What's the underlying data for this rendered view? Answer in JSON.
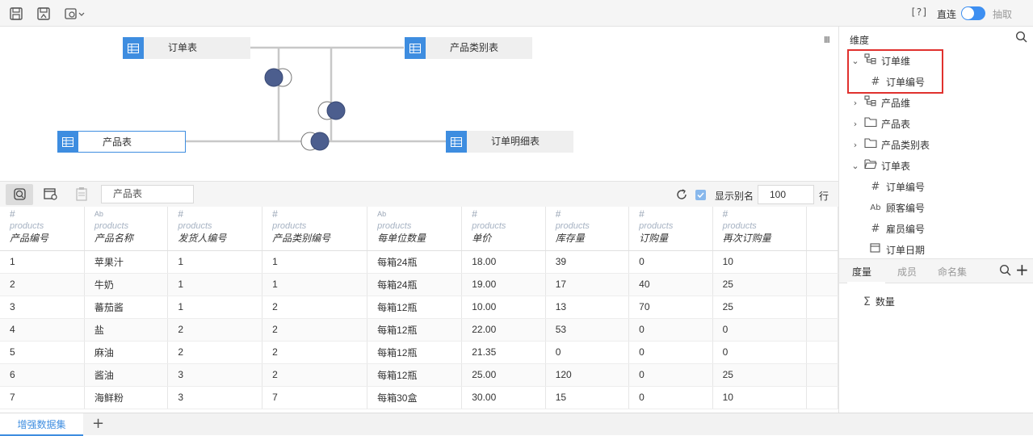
{
  "toolbar": {
    "help_label": "[?]",
    "direct_label": "直连",
    "extract_label": "抽取",
    "icons": [
      "save-icon",
      "save-as-icon",
      "settings-dropdown-icon"
    ]
  },
  "diagram": {
    "menu_glyph": "III",
    "tables": [
      {
        "label": "订单表"
      },
      {
        "label": "产品类别表"
      },
      {
        "label": "产品表"
      },
      {
        "label": "订单明细表"
      }
    ]
  },
  "preview": {
    "table_select_value": "产品表",
    "show_alias_label": "显示别名",
    "rows_value": "100",
    "rows_unit": "行"
  },
  "grid": {
    "columns": [
      {
        "type_glyph": "#",
        "type": "number",
        "source": "products",
        "name": "产品编号"
      },
      {
        "type_glyph": "Ab",
        "type": "text",
        "source": "products",
        "name": "产品名称"
      },
      {
        "type_glyph": "#",
        "type": "number",
        "source": "products",
        "name": "发货人编号"
      },
      {
        "type_glyph": "#",
        "type": "number",
        "source": "products",
        "name": "产品类别编号"
      },
      {
        "type_glyph": "Ab",
        "type": "text",
        "source": "products",
        "name": "每单位数量"
      },
      {
        "type_glyph": "#",
        "type": "number",
        "source": "products",
        "name": "单价"
      },
      {
        "type_glyph": "#",
        "type": "number",
        "source": "products",
        "name": "库存量"
      },
      {
        "type_glyph": "#",
        "type": "number",
        "source": "products",
        "name": "订购量"
      },
      {
        "type_glyph": "#",
        "type": "number",
        "source": "products",
        "name": "再次订购量"
      },
      {
        "type_glyph": "",
        "type": "number",
        "source": "",
        "name": ""
      }
    ],
    "rows": [
      [
        "1",
        "苹果汁",
        "1",
        "1",
        "每箱24瓶",
        "18.00",
        "39",
        "0",
        "10",
        ""
      ],
      [
        "2",
        "牛奶",
        "1",
        "1",
        "每箱24瓶",
        "19.00",
        "17",
        "40",
        "25",
        ""
      ],
      [
        "3",
        "蕃茄酱",
        "1",
        "2",
        "每箱12瓶",
        "10.00",
        "13",
        "70",
        "25",
        ""
      ],
      [
        "4",
        "盐",
        "2",
        "2",
        "每箱12瓶",
        "22.00",
        "53",
        "0",
        "0",
        ""
      ],
      [
        "5",
        "麻油",
        "2",
        "2",
        "每箱12瓶",
        "21.35",
        "0",
        "0",
        "0",
        ""
      ],
      [
        "6",
        "酱油",
        "3",
        "2",
        "每箱12瓶",
        "25.00",
        "120",
        "0",
        "25",
        ""
      ],
      [
        "7",
        "海鲜粉",
        "3",
        "7",
        "每箱30盒",
        "30.00",
        "15",
        "0",
        "10",
        ""
      ]
    ]
  },
  "right_panel": {
    "dimension_title": "维度",
    "tree": [
      {
        "label": "订单维",
        "chevron": "⌄",
        "icon": "hierarchy-icon",
        "glyph": "",
        "level": 0
      },
      {
        "label": "订单编号",
        "chevron": "",
        "icon": "number-icon",
        "glyph": "#",
        "level": 1
      },
      {
        "label": "产品维",
        "chevron": "›",
        "icon": "hierarchy-icon",
        "glyph": "",
        "level": 0
      },
      {
        "label": "产品表",
        "chevron": "›",
        "icon": "folder-icon",
        "glyph": "",
        "level": 0
      },
      {
        "label": "产品类别表",
        "chevron": "›",
        "icon": "folder-icon",
        "glyph": "",
        "level": 0
      },
      {
        "label": "订单表",
        "chevron": "⌄",
        "icon": "folder-open-icon",
        "glyph": "",
        "level": 0
      },
      {
        "label": "订单编号",
        "chevron": "",
        "icon": "number-icon",
        "glyph": "#",
        "level": 1
      },
      {
        "label": "顾客编号",
        "chevron": "",
        "icon": "text-icon",
        "glyph": "Ab",
        "level": 1
      },
      {
        "label": "雇员编号",
        "chevron": "",
        "icon": "number-icon",
        "glyph": "#",
        "level": 1
      },
      {
        "label": "订单日期",
        "chevron": "",
        "icon": "date-icon",
        "glyph": "",
        "level": 1
      }
    ],
    "measure_tabs": [
      "度量",
      "成员",
      "命名集"
    ],
    "measure_add": "+",
    "measures": [
      {
        "label": "数量",
        "glyph": "Σ"
      }
    ]
  },
  "bottom": {
    "tab_label": "增强数据集",
    "add_label": "+"
  }
}
